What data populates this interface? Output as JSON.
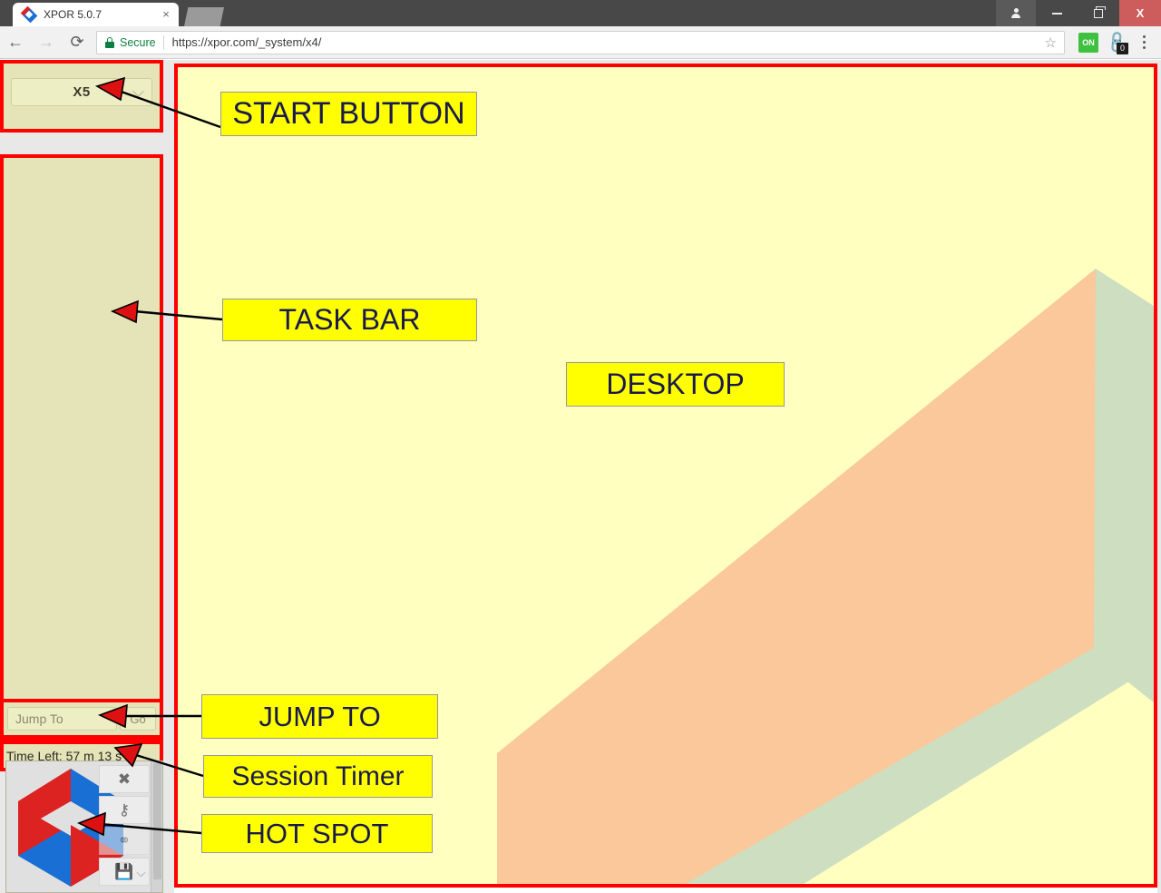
{
  "browser": {
    "tab": {
      "title": "XPOR 5.0.7",
      "favicon_name": "xpor-diamond-favicon",
      "close_label": "×"
    },
    "new_tab_label": "",
    "window_controls": {
      "profile_label": "",
      "minimize_label": "",
      "maximize_label": "",
      "close_label": "X"
    },
    "toolbar": {
      "back_label": "←",
      "forward_label": "→",
      "reload_label": "⟳",
      "security_label": "Secure",
      "url": "https://xpor.com/_system/x4/",
      "bookmark_label": "☆",
      "extension_on_label": "ON",
      "extension_link_label": "🔗",
      "extension_badge_count": "0",
      "menu_label": ""
    }
  },
  "app": {
    "start_button": {
      "selected_value": "X5",
      "chevron_name": "chevron-down-icon"
    },
    "task_bar": {
      "items": []
    },
    "jump_to": {
      "placeholder": "Jump To",
      "value": "",
      "go_label": "Go"
    },
    "session_timer": {
      "text": "Time Left: 57 m 13 s"
    },
    "hot_spot": {
      "logo_name": "xpor-cube-logo",
      "buttons": [
        {
          "name": "close-button",
          "glyph": "✖"
        },
        {
          "name": "key-button",
          "glyph": "⚷"
        },
        {
          "name": "link-button",
          "glyph": "⚭"
        },
        {
          "name": "save-button",
          "glyph": "💾"
        }
      ]
    },
    "desktop": {
      "background_color": "#ffffc0",
      "shapes": [
        {
          "name": "orange-diagonal-band",
          "color": "#fac89a"
        },
        {
          "name": "green-peak",
          "color": "#cddfc0"
        },
        {
          "name": "green-lower-wedge",
          "color": "#cddfc0"
        }
      ]
    }
  },
  "annotations": {
    "highlight_color": "#ff0000",
    "callout_bg": "#ffff00",
    "callout_text_color": "#1a1a4e",
    "items": [
      {
        "id": "start-button",
        "label": "START BUTTON",
        "font_size": 34
      },
      {
        "id": "task-bar",
        "label": "TASK BAR",
        "font_size": 32
      },
      {
        "id": "desktop",
        "label": "DESKTOP",
        "font_size": 32
      },
      {
        "id": "jump-to",
        "label": "JUMP TO",
        "font_size": 31
      },
      {
        "id": "session-timer",
        "label": "Session Timer",
        "font_size": 30
      },
      {
        "id": "hot-spot",
        "label": "HOT SPOT",
        "font_size": 31
      }
    ]
  }
}
